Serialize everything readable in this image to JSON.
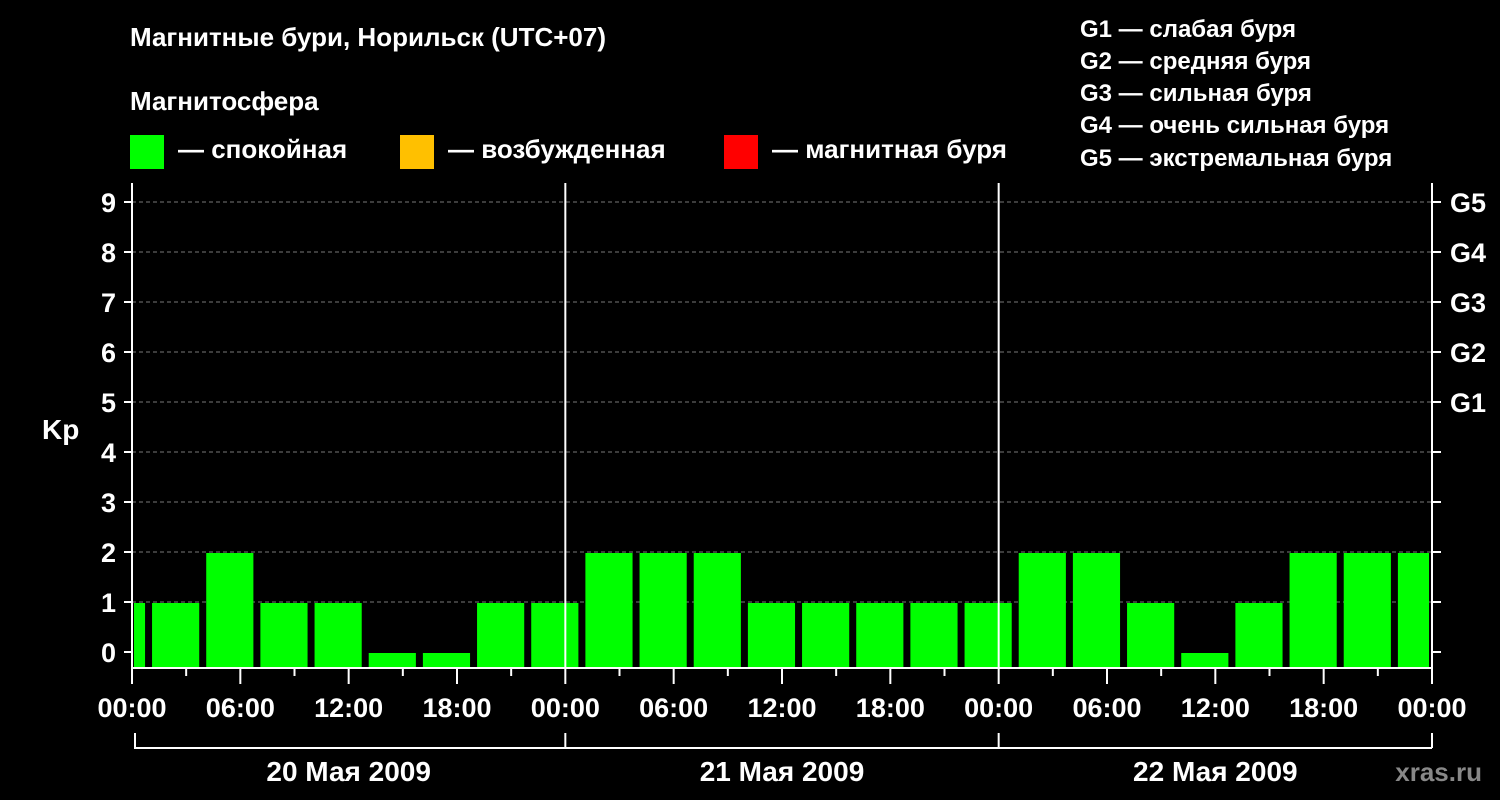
{
  "header": {
    "title": "Магнитные бури, Норильск (UTC+07)",
    "subtitle": "Магнитосфера"
  },
  "legend": [
    {
      "color": "#00ff00",
      "label": "— спокойная"
    },
    {
      "color": "#ffc000",
      "label": "— возбужденная"
    },
    {
      "color": "#ff0000",
      "label": "— магнитная буря"
    }
  ],
  "storm_legend": [
    "G1 — слабая буря",
    "G2 — средняя буря",
    "G3 — сильная буря",
    "G4 — очень сильная буря",
    "G5 — экстремальная буря"
  ],
  "watermark": "xras.ru",
  "chart_data": {
    "type": "bar",
    "ylabel": "Kp",
    "ylim": [
      0,
      9
    ],
    "yticks": [
      0,
      1,
      2,
      3,
      4,
      5,
      6,
      7,
      8,
      9
    ],
    "right_ticks": [
      {
        "value": 5,
        "label": "G1"
      },
      {
        "value": 6,
        "label": "G2"
      },
      {
        "value": 7,
        "label": "G3"
      },
      {
        "value": 8,
        "label": "G4"
      },
      {
        "value": 9,
        "label": "G5"
      }
    ],
    "xrange_hours": [
      0,
      72
    ],
    "x_tick_labels": [
      "00:00",
      "06:00",
      "12:00",
      "18:00",
      "00:00",
      "06:00",
      "12:00",
      "18:00",
      "00:00",
      "06:00",
      "12:00",
      "18:00",
      "00:00"
    ],
    "days": [
      "20 Мая 2009",
      "21 Мая 2009",
      "22 Мая 2009"
    ],
    "grid": true,
    "bar_color": "#00ff00",
    "bars": [
      {
        "start_hour": 0,
        "end_hour": 1,
        "kp": 1
      },
      {
        "start_hour": 1,
        "end_hour": 4,
        "kp": 1
      },
      {
        "start_hour": 4,
        "end_hour": 7,
        "kp": 2
      },
      {
        "start_hour": 7,
        "end_hour": 10,
        "kp": 1
      },
      {
        "start_hour": 10,
        "end_hour": 13,
        "kp": 1
      },
      {
        "start_hour": 13,
        "end_hour": 16,
        "kp": 0
      },
      {
        "start_hour": 16,
        "end_hour": 19,
        "kp": 0
      },
      {
        "start_hour": 19,
        "end_hour": 22,
        "kp": 1
      },
      {
        "start_hour": 22,
        "end_hour": 25,
        "kp": 1
      },
      {
        "start_hour": 25,
        "end_hour": 28,
        "kp": 2
      },
      {
        "start_hour": 28,
        "end_hour": 31,
        "kp": 2
      },
      {
        "start_hour": 31,
        "end_hour": 34,
        "kp": 2
      },
      {
        "start_hour": 34,
        "end_hour": 37,
        "kp": 1
      },
      {
        "start_hour": 37,
        "end_hour": 40,
        "kp": 1
      },
      {
        "start_hour": 40,
        "end_hour": 43,
        "kp": 1
      },
      {
        "start_hour": 43,
        "end_hour": 46,
        "kp": 1
      },
      {
        "start_hour": 46,
        "end_hour": 49,
        "kp": 1
      },
      {
        "start_hour": 49,
        "end_hour": 52,
        "kp": 2
      },
      {
        "start_hour": 52,
        "end_hour": 55,
        "kp": 2
      },
      {
        "start_hour": 55,
        "end_hour": 58,
        "kp": 1
      },
      {
        "start_hour": 58,
        "end_hour": 61,
        "kp": 0
      },
      {
        "start_hour": 61,
        "end_hour": 64,
        "kp": 1
      },
      {
        "start_hour": 64,
        "end_hour": 67,
        "kp": 2
      },
      {
        "start_hour": 67,
        "end_hour": 70,
        "kp": 2
      },
      {
        "start_hour": 70,
        "end_hour": 72,
        "kp": 2
      }
    ]
  }
}
